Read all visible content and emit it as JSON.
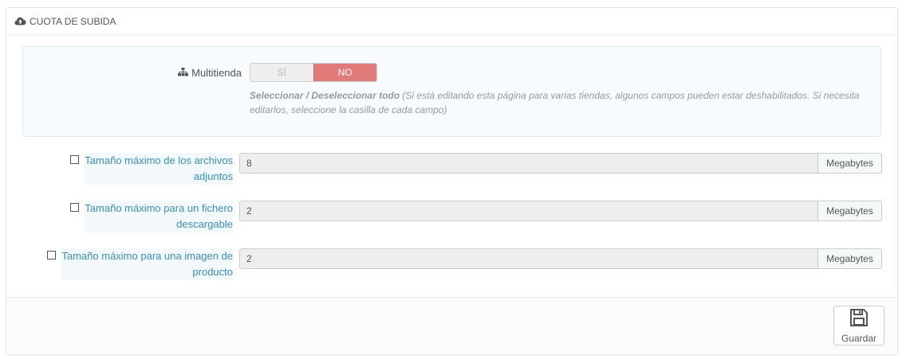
{
  "panel": {
    "title": "CUOTA DE SUBIDA",
    "title_icon": "cloud-upload-icon"
  },
  "multishop": {
    "icon": "sitemap-icon",
    "label": "Multitienda",
    "switch": {
      "yes_label": "SÍ",
      "no_label": "NO",
      "selected": "NO"
    },
    "help_bold": "Seleccionar / Deseleccionar todo",
    "help_text": "(Si está editando esta página para varias tiendas, algunos campos pueden estar deshabilitados. Si necesita editarlos, seleccione la casilla de cada campo)"
  },
  "fields": [
    {
      "label_line1": "Tamaño máximo de los archivos",
      "label_line2": "adjuntos",
      "value": "8",
      "unit": "Megabytes",
      "checked": false
    },
    {
      "label_line1": "Tamaño máximo para un fichero",
      "label_line2": "descargable",
      "value": "2",
      "unit": "Megabytes",
      "checked": false
    },
    {
      "label_line1": "Tamaño máximo para una imagen de",
      "label_line2": "producto",
      "value": "2",
      "unit": "Megabytes",
      "checked": false
    }
  ],
  "footer": {
    "save_label": "Guardar",
    "save_icon": "save-icon"
  },
  "colors": {
    "switch_no_bg": "#e07b79",
    "label_blue": "#3a8fb7",
    "input_bg": "#eeeeee"
  }
}
